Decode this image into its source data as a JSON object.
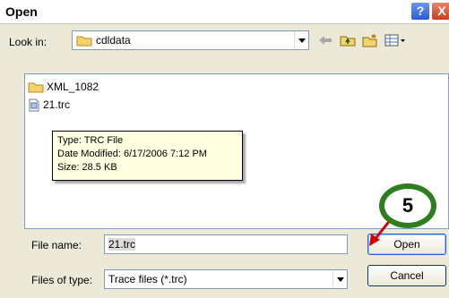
{
  "window": {
    "title": "Open"
  },
  "titlebar": {
    "help_glyph": "?",
    "close_glyph": "X"
  },
  "lookin": {
    "label": "Look in:",
    "value": "cdldata"
  },
  "files": [
    {
      "name": "XML_1082",
      "icon": "folder-icon"
    },
    {
      "name": "21.trc",
      "icon": "file-icon"
    }
  ],
  "tooltip": {
    "line1": "Type: TRC File",
    "line2": "Date Modified: 6/17/2006 7:12 PM",
    "line3": "Size: 28.5 KB"
  },
  "filename": {
    "label": "File name:",
    "value": "21.trc"
  },
  "filetype": {
    "label": "Files of type:",
    "value": "Trace files (*.trc)"
  },
  "buttons": {
    "open": "Open",
    "cancel": "Cancel"
  },
  "callout": {
    "number": "5"
  },
  "colors": {
    "callout_ring": "#2e7d1e",
    "arrow": "#d40000",
    "tooltip_bg": "#ffffe1"
  }
}
